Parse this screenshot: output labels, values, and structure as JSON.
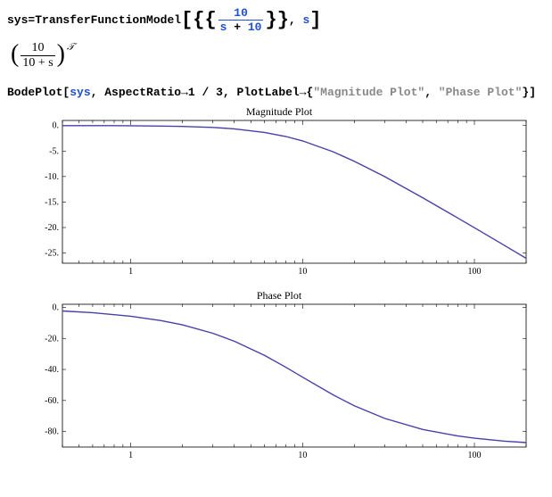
{
  "code1": {
    "lhs": "sys",
    "eq": " = ",
    "fn": "TransferFunctionModel",
    "num": "10",
    "den_a": "s",
    "den_op": " + ",
    "den_b": "10",
    "var": "s"
  },
  "output": {
    "num": "10",
    "den": "10 + s",
    "sup": "𝒯"
  },
  "code2": {
    "fn": "BodePlot",
    "arg1": "sys",
    "opt1k": "AspectRatio",
    "arrow": " → ",
    "opt1v": "1 / 3",
    "opt2k": "PlotLabel",
    "label1": "\"Magnitude Plot\"",
    "label2": "\"Phase Plot\""
  },
  "chart_data": [
    {
      "type": "line",
      "title": "Magnitude Plot",
      "xlabel": "",
      "ylabel": "",
      "xscale": "log",
      "xlim": [
        0.4,
        200
      ],
      "ylim": [
        -27,
        1
      ],
      "xticks": [
        1,
        10,
        100
      ],
      "yticks": [
        0,
        -5,
        -10,
        -15,
        -20,
        -25
      ],
      "series": [
        {
          "name": "magnitude",
          "x": [
            0.4,
            0.6,
            1,
            1.5,
            2,
            3,
            4,
            6,
            8,
            10,
            15,
            20,
            30,
            50,
            80,
            100,
            150,
            200
          ],
          "y": [
            -0.01,
            -0.02,
            -0.04,
            -0.1,
            -0.17,
            -0.37,
            -0.64,
            -1.34,
            -2.15,
            -3.01,
            -5.12,
            -6.99,
            -10.0,
            -14.15,
            -18.13,
            -20.04,
            -23.54,
            -26.03
          ]
        }
      ]
    },
    {
      "type": "line",
      "title": "Phase Plot",
      "xlabel": "",
      "ylabel": "",
      "xscale": "log",
      "xlim": [
        0.4,
        200
      ],
      "ylim": [
        -90,
        2
      ],
      "xticks": [
        1,
        10,
        100
      ],
      "yticks": [
        0,
        -20,
        -40,
        -60,
        -80
      ],
      "series": [
        {
          "name": "phase",
          "x": [
            0.4,
            0.6,
            1,
            1.5,
            2,
            3,
            4,
            6,
            8,
            10,
            15,
            20,
            30,
            50,
            80,
            100,
            150,
            200
          ],
          "y": [
            -2.29,
            -3.43,
            -5.71,
            -8.53,
            -11.31,
            -16.7,
            -21.8,
            -30.96,
            -38.66,
            -45.0,
            -56.31,
            -63.43,
            -71.57,
            -78.69,
            -82.87,
            -84.29,
            -86.19,
            -87.14
          ]
        }
      ]
    }
  ]
}
